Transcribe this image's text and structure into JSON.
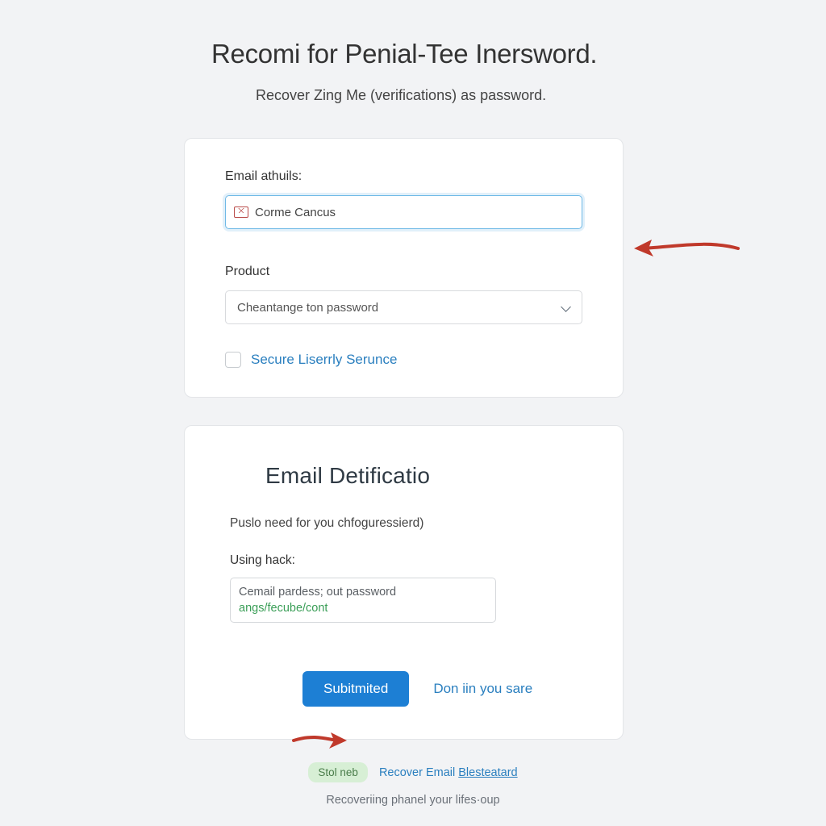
{
  "header": {
    "title": "Recomi for Penial-Tee Inersword.",
    "subtitle": "Recover Zing Me (verifications) as password."
  },
  "card1": {
    "email_label": "Email athuils:",
    "email_value": "Corme Cancus",
    "product_label": "Product",
    "product_selected": "Cheantange ton password",
    "checkbox_label": "Secure Liserrly Serunce"
  },
  "card2": {
    "title": "Email Detificatio",
    "subtitle": "Puslo need for you chfoguressierd)",
    "using_label": "Using hack:",
    "textarea_line1": "Cemail pardess; out password",
    "textarea_line2": "angs/fecube/cont",
    "submit_label": "Subitmited",
    "secondary_link": "Don iin you sare"
  },
  "footer": {
    "badge": "Stol neb",
    "link_prefix": "Recover Email ",
    "link_underlined": "Blesteatard",
    "line2": "Recoveriing phanel your lifes·oup"
  }
}
